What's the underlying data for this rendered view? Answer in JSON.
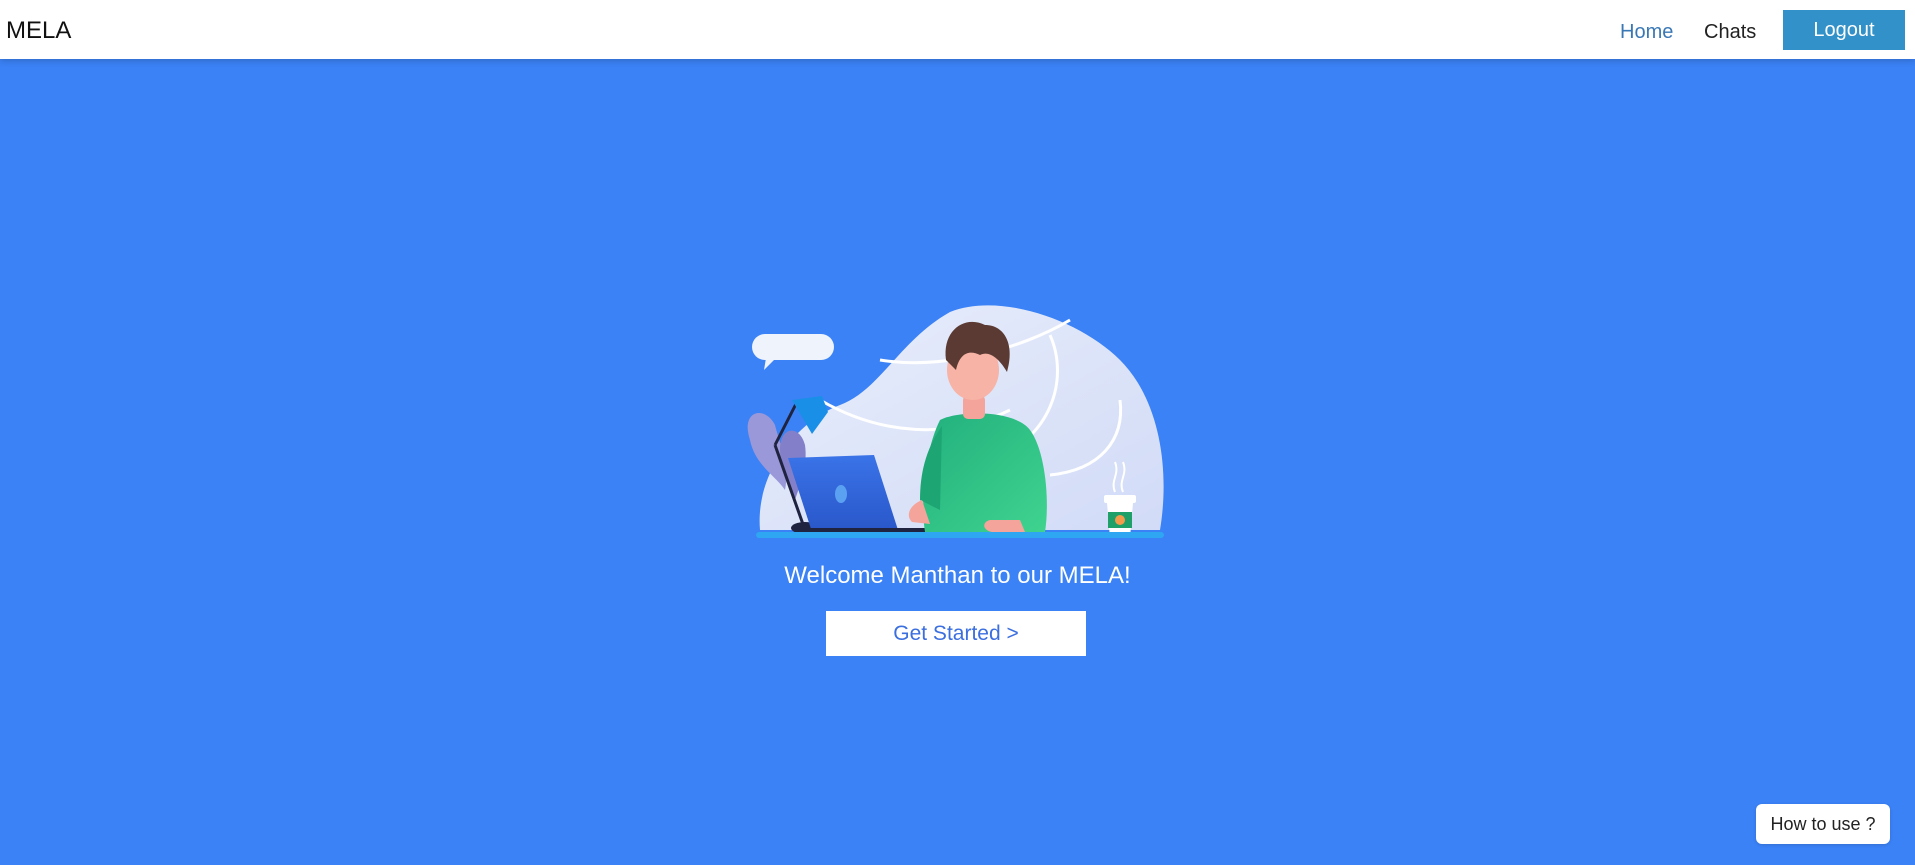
{
  "navbar": {
    "brand": "MELA",
    "links": [
      {
        "label": "Home",
        "active": true
      },
      {
        "label": "Chats",
        "active": false
      }
    ],
    "logout_label": "Logout"
  },
  "main": {
    "illustration": "person-working-at-laptop-illustration",
    "welcome_text": "Welcome Manthan to our MELA!",
    "get_started_label": "Get Started >"
  },
  "help": {
    "how_to_use_label": "How to use ?"
  },
  "colors": {
    "background": "#3b82f6",
    "navbar": "#ffffff",
    "logout_button": "#3191c8",
    "active_link": "#3a78b5",
    "get_started_text": "#3b6fe0"
  }
}
